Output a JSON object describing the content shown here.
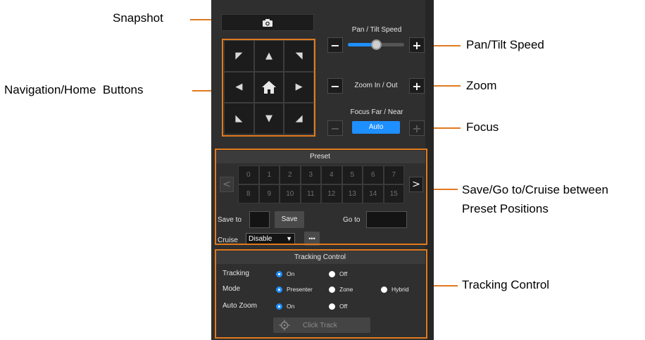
{
  "callouts": {
    "snapshot": "Snapshot",
    "nav_home": "Navigation/Home  Buttons",
    "pan_tilt_speed": "Pan/Tilt Speed",
    "zoom": "Zoom",
    "focus": "Focus",
    "preset_line1": "Save/Go to/Cruise between",
    "preset_line2": "Preset Positions",
    "tracking": "Tracking Control"
  },
  "controls": {
    "pan_tilt_label": "Pan / Tilt Speed",
    "pan_tilt_speed_level": 0.5,
    "zoom_label": "Zoom In / Out",
    "focus_label": "Focus Far / Near",
    "focus_auto": "Auto",
    "minus": "−",
    "plus": "+"
  },
  "nav": {
    "up_left": "◤",
    "up": "▲",
    "up_right": "◥",
    "left": "◀",
    "home": "⌂",
    "right": "▶",
    "down_left": "◣",
    "down": "▼",
    "down_right": "◢"
  },
  "preset": {
    "header": "Preset",
    "numbers": [
      "0",
      "1",
      "2",
      "3",
      "4",
      "5",
      "6",
      "7",
      "8",
      "9",
      "10",
      "11",
      "12",
      "13",
      "14",
      "15"
    ],
    "prev": "<",
    "next": ">",
    "save_to_label": "Save to",
    "save_button": "Save",
    "go_to_label": "Go to",
    "cruise_label": "Cruise",
    "cruise_value": "Disable",
    "more": "•••"
  },
  "tracking": {
    "header": "Tracking Control",
    "tracking_label": "Tracking",
    "tracking_on": "On",
    "tracking_off": "Off",
    "mode_label": "Mode",
    "mode_presenter": "Presenter",
    "mode_zone": "Zone",
    "mode_hybrid": "Hybrid",
    "autozoom_label": "Auto Zoom",
    "autozoom_on": "On",
    "autozoom_off": "Off",
    "click_track": "Click Track"
  },
  "colors": {
    "accent_orange": "#e07a1f",
    "accent_blue": "#1e8fff",
    "panel_bg": "#2f2f2f"
  }
}
